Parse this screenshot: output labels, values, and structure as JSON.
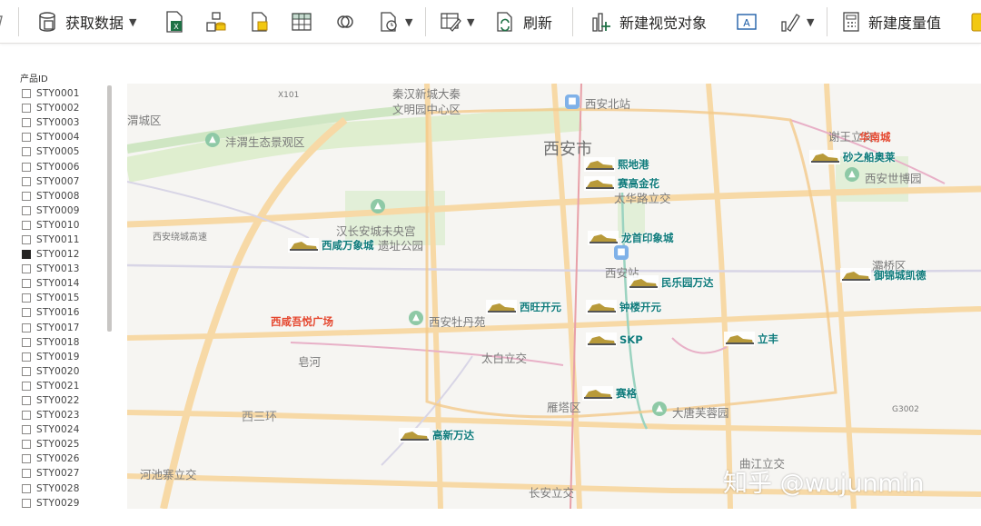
{
  "ribbon": {
    "get_data": "获取数据",
    "refresh": "刷新",
    "new_visual": "新建视觉对象",
    "new_measure": "新建度量值"
  },
  "slicer": {
    "title": "产品ID",
    "items": [
      {
        "label": "STY0001",
        "checked": false
      },
      {
        "label": "STY0002",
        "checked": false
      },
      {
        "label": "STY0003",
        "checked": false
      },
      {
        "label": "STY0004",
        "checked": false
      },
      {
        "label": "STY0005",
        "checked": false
      },
      {
        "label": "STY0006",
        "checked": false
      },
      {
        "label": "STY0007",
        "checked": false
      },
      {
        "label": "STY0008",
        "checked": false
      },
      {
        "label": "STY0009",
        "checked": false
      },
      {
        "label": "STY0010",
        "checked": false
      },
      {
        "label": "STY0011",
        "checked": false
      },
      {
        "label": "STY0012",
        "checked": true
      },
      {
        "label": "STY0013",
        "checked": false
      },
      {
        "label": "STY0014",
        "checked": false
      },
      {
        "label": "STY0015",
        "checked": false
      },
      {
        "label": "STY0016",
        "checked": false
      },
      {
        "label": "STY0017",
        "checked": false
      },
      {
        "label": "STY0018",
        "checked": false
      },
      {
        "label": "STY0019",
        "checked": false
      },
      {
        "label": "STY0020",
        "checked": false
      },
      {
        "label": "STY0021",
        "checked": false
      },
      {
        "label": "STY0022",
        "checked": false
      },
      {
        "label": "STY0023",
        "checked": false
      },
      {
        "label": "STY0024",
        "checked": false
      },
      {
        "label": "STY0025",
        "checked": false
      },
      {
        "label": "STY0026",
        "checked": false
      },
      {
        "label": "STY0027",
        "checked": false
      },
      {
        "label": "STY0028",
        "checked": false
      },
      {
        "label": "STY0029",
        "checked": false
      }
    ]
  },
  "map": {
    "places": {
      "weicheng": "渭城区",
      "qinhan": "秦汉新城大秦",
      "wenming": "文明园中心区",
      "xian_north": "西安北站",
      "chanba": "沣渭生态景观区",
      "xian_city": "西安市",
      "xiewang": "谢王立交",
      "huanan": "华南城",
      "shibo": "西安世博园",
      "hancheng": "汉长安城未央宫",
      "yizhi": "遗址公园",
      "taihua": "太华路立交",
      "xian_station": "西安站",
      "baqiao": "灞桥区",
      "xixian_wuyue": "西咸吾悦广场",
      "peony": "西安牡丹苑",
      "taibai": "太白立交",
      "yanta": "雁塔区",
      "furong": "大唐芙蓉园",
      "xisan": "西三环",
      "qujiang": "曲江立交",
      "hechi": "河池寨立交",
      "changan": "长安立交",
      "zaohe": "皂河",
      "shuanghuan": "西安绕城高速",
      "x101": "X101",
      "g3002": "G3002"
    },
    "stores": [
      {
        "name": "熙地港"
      },
      {
        "name": "赛高金花"
      },
      {
        "name": "砂之船奥莱"
      },
      {
        "name": "龙首印象城"
      },
      {
        "name": "西咸万象城"
      },
      {
        "name": "民乐园万达"
      },
      {
        "name": "御锦城凯德"
      },
      {
        "name": "西旺开元"
      },
      {
        "name": "钟楼开元"
      },
      {
        "name": "SKP"
      },
      {
        "name": "立丰"
      },
      {
        "name": "赛格"
      },
      {
        "name": "高新万达"
      }
    ]
  },
  "watermark": "知乎 @wujunmin"
}
